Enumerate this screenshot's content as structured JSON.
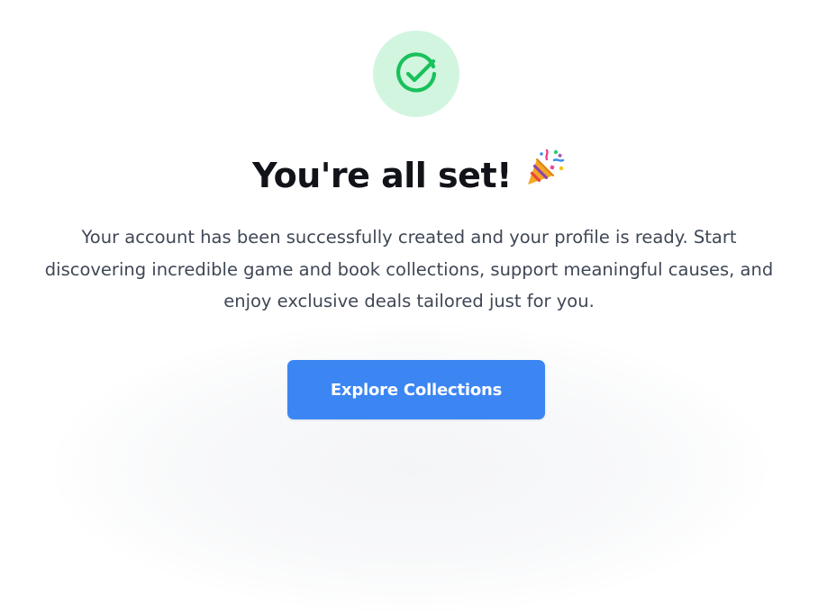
{
  "confirmation": {
    "title": "You're all set!",
    "title_emoji": "🎉",
    "message": "Your account has been successfully created and your profile is ready. Start discovering incredible game and book collections, support meaningful causes, and enjoy exclusive deals tailored just for you.",
    "cta_label": "Explore Collections",
    "icon": "check-circle-icon",
    "colors": {
      "badge_background": "#d2f5df",
      "check_stroke": "#19c15a",
      "button_background": "#3c86f4",
      "heading_text": "#111318",
      "body_text": "#3f4756"
    }
  }
}
